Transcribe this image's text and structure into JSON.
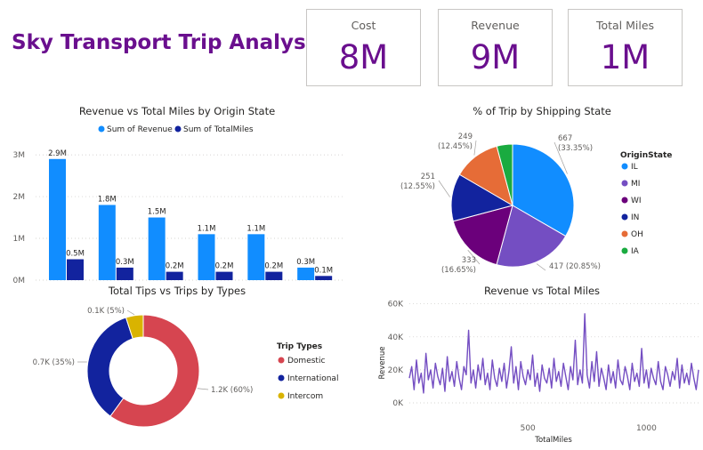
{
  "dashboard": {
    "title": "Sky Transport Trip Analysis"
  },
  "cards": [
    {
      "label": "Cost",
      "value": "8M"
    },
    {
      "label": "Revenue",
      "value": "9M"
    },
    {
      "label": "Total Miles",
      "value": "1M"
    }
  ],
  "colors": {
    "accent": "#6a0f8e",
    "light_blue": "#118dff",
    "dark_blue": "#12239e",
    "purple": "#744ec2",
    "dark_purple": "#6b007b",
    "orange": "#e66c37",
    "teal": "#1aab40",
    "red": "#d64550",
    "gold": "#d9b300"
  },
  "chart_data": [
    {
      "type": "bar",
      "title": "Revenue vs Total Miles by Origin State",
      "categories": [
        "IL",
        "MI",
        "WI",
        "IN",
        "OH",
        "IA"
      ],
      "series": [
        {
          "name": "Sum of Revenue",
          "values": [
            2900000,
            1800000,
            1500000,
            1100000,
            1100000,
            300000
          ],
          "labels": [
            "2.9M",
            "1.8M",
            "1.5M",
            "1.1M",
            "1.1M",
            "0.3M"
          ]
        },
        {
          "name": "Sum of TotalMiles",
          "values": [
            500000,
            300000,
            200000,
            200000,
            200000,
            100000
          ],
          "labels": [
            "0.5M",
            "0.3M",
            "0.2M",
            "0.2M",
            "0.2M",
            "0.1M"
          ]
        }
      ],
      "ylim": [
        0,
        3300000
      ],
      "yticks": [
        0,
        1000000,
        2000000,
        3000000
      ],
      "ytick_labels": [
        "0M",
        "1M",
        "2M",
        "3M"
      ],
      "grid": true,
      "legend": "top"
    },
    {
      "type": "pie",
      "title": "% of Trip by Shipping State",
      "legend_title": "OriginState",
      "legend": "right",
      "slices": [
        {
          "label": "IL",
          "value": 667,
          "pct": "33.35%"
        },
        {
          "label": "MI",
          "value": 417,
          "pct": "20.85%"
        },
        {
          "label": "WI",
          "value": 333,
          "pct": "16.65%"
        },
        {
          "label": "IN",
          "value": 251,
          "pct": "12.55%"
        },
        {
          "label": "OH",
          "value": 249,
          "pct": "12.45%"
        },
        {
          "label": "IA",
          "value": 83,
          "pct": ""
        }
      ],
      "data_labels": {
        "IL": [
          "667",
          "(33.35%)"
        ],
        "MI": [
          "417 (20.85%)"
        ],
        "WI": [
          "333",
          "(16.65%)"
        ],
        "IN": [
          "251",
          "(12.55%)"
        ],
        "OH": [
          "249",
          "(12.45%)"
        ]
      }
    },
    {
      "type": "pie",
      "subtype": "donut",
      "title": "Total Tips vs Trips by Types",
      "legend_title": "Trip Types",
      "legend": "right",
      "slices": [
        {
          "label": "Domestic",
          "value": 60,
          "text": "1.2K (60%)"
        },
        {
          "label": "International",
          "value": 35,
          "text": "0.7K (35%)"
        },
        {
          "label": "Intercom",
          "value": 5,
          "text": "0.1K (5%)"
        }
      ]
    },
    {
      "type": "line",
      "title": "Revenue vs Total Miles",
      "xlabel": "TotalMiles",
      "ylabel": "Revenue",
      "xlim": [
        0,
        1220
      ],
      "ylim": [
        0,
        62000
      ],
      "xticks": [
        500,
        1000
      ],
      "xtick_labels": [
        "500",
        "1000"
      ],
      "yticks": [
        0,
        20000,
        40000,
        60000
      ],
      "ytick_labels": [
        "0K",
        "20K",
        "40K",
        "60K"
      ],
      "grid": true,
      "series": [
        {
          "name": "Revenue",
          "x": [
            0,
            10,
            20,
            30,
            40,
            50,
            60,
            70,
            80,
            90,
            100,
            110,
            120,
            130,
            140,
            150,
            160,
            170,
            180,
            190,
            200,
            210,
            220,
            230,
            240,
            250,
            260,
            270,
            280,
            290,
            300,
            310,
            320,
            330,
            340,
            350,
            360,
            370,
            380,
            390,
            400,
            410,
            420,
            430,
            440,
            450,
            460,
            470,
            480,
            490,
            500,
            510,
            520,
            530,
            540,
            550,
            560,
            570,
            580,
            590,
            600,
            610,
            620,
            630,
            640,
            650,
            660,
            670,
            680,
            690,
            700,
            710,
            720,
            730,
            740,
            750,
            760,
            770,
            780,
            790,
            800,
            810,
            820,
            830,
            840,
            850,
            860,
            870,
            880,
            890,
            900,
            910,
            920,
            930,
            940,
            950,
            960,
            970,
            980,
            990,
            1000,
            1010,
            1020,
            1030,
            1040,
            1050,
            1060,
            1070,
            1080,
            1090,
            1100,
            1110,
            1120,
            1130,
            1140,
            1150,
            1160,
            1170,
            1180,
            1190,
            1200,
            1210,
            1220
          ],
          "y": [
            15000,
            22000,
            8000,
            26000,
            12000,
            18000,
            6000,
            30000,
            14000,
            20000,
            9000,
            24000,
            16000,
            11000,
            21000,
            7000,
            28000,
            13000,
            19000,
            10000,
            25000,
            15000,
            8000,
            22000,
            17000,
            44000,
            12000,
            20000,
            9000,
            23000,
            14000,
            27000,
            11000,
            18000,
            8000,
            26000,
            15000,
            10000,
            21000,
            13000,
            24000,
            9000,
            19000,
            34000,
            12000,
            22000,
            8000,
            25000,
            16000,
            11000,
            20000,
            14000,
            29000,
            10000,
            18000,
            7000,
            23000,
            15000,
            12000,
            21000,
            9000,
            27000,
            13000,
            19000,
            10000,
            24000,
            16000,
            8000,
            22000,
            14000,
            38000,
            11000,
            20000,
            12000,
            54000,
            17000,
            9000,
            25000,
            13000,
            31000,
            10000,
            21000,
            15000,
            8000,
            23000,
            12000,
            19000,
            9000,
            26000,
            14000,
            11000,
            22000,
            16000,
            8000,
            24000,
            13000,
            18000,
            10000,
            33000,
            12000,
            20000,
            9000,
            21000,
            15000,
            11000,
            25000,
            13000,
            8000,
            22000,
            17000,
            10000,
            19000,
            14000,
            27000,
            9000,
            23000,
            12000,
            18000,
            11000,
            24000,
            15000,
            8000,
            20000
          ]
        }
      ]
    }
  ]
}
